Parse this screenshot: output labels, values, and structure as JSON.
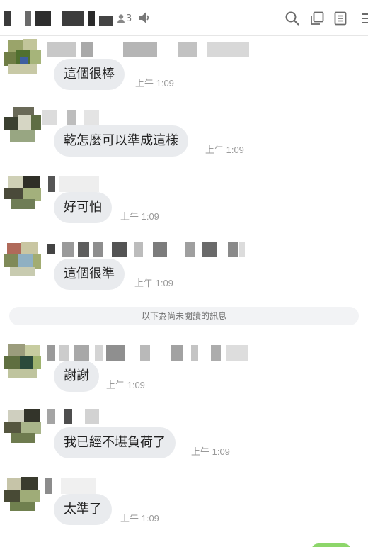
{
  "header": {
    "member_count": "3",
    "icons": [
      "person-icon",
      "speaker-icon",
      "search-icon",
      "copy-icon",
      "notes-icon",
      "menu-icon"
    ]
  },
  "messages": [
    {
      "text": "這個很棒",
      "time": "上午 1:09"
    },
    {
      "text": "乾怎麼可以準成這樣",
      "time": "上午 1:09"
    },
    {
      "text": "好可怕",
      "time": "上午 1:09"
    },
    {
      "text": "這個很準",
      "time": "上午 1:09"
    },
    {
      "text": "謝謝",
      "time": "上午 1:09"
    },
    {
      "text": "我已經不堪負荷了",
      "time": "上午 1:09"
    },
    {
      "text": "太準了",
      "time": "上午 1:09"
    }
  ],
  "unread_divider": "以下為尚未閱讀的訊息",
  "colors": {
    "bubble": "#e9ebee",
    "time": "#9a9a9a",
    "divider_bg": "#f2f3f5",
    "own_bubble": "#8dd66a"
  }
}
